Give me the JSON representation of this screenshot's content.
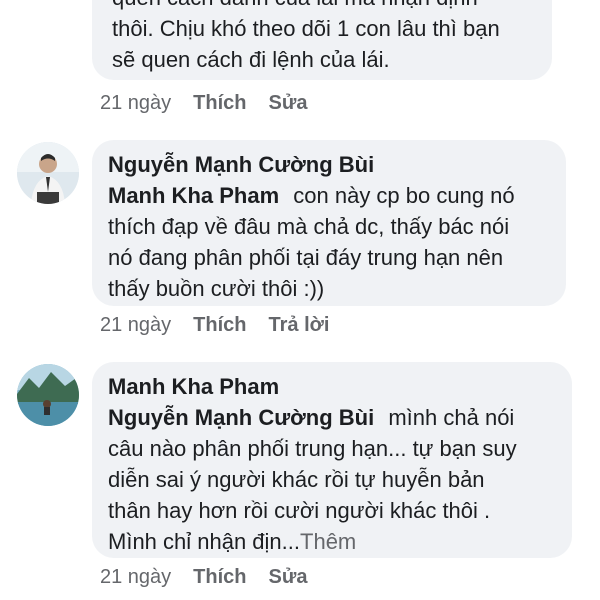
{
  "comment1": {
    "lines": [
      "quen cách đánh của lái mà nhận định",
      "thôi. Chịu khó theo dõi 1 con lâu thì bạn",
      "sẽ quen cách đi lệnh của lái."
    ],
    "time": "21 ngày",
    "like_label": "Thích",
    "edit_label": "Sửa"
  },
  "comment2": {
    "author": "Nguyễn Mạnh Cường Bùi",
    "mention": "Manh Kha Pham",
    "line1_rest": "con này cp bo cung nó",
    "lines": [
      "thích đạp về đâu mà chả dc, thấy bác nói",
      "nó đang phân phối tại đáy trung hạn nên",
      "thấy buồn cười thôi :))"
    ],
    "time": "21 ngày",
    "like_label": "Thích",
    "reply_label": "Trả lời"
  },
  "comment3": {
    "author": "Manh Kha Pham",
    "mention": "Nguyễn Mạnh Cường Bùi",
    "line1_rest": "mình chả nói",
    "lines": [
      "câu nào phân phối trung hạn... tự bạn suy",
      "diễn sai ý người khác rồi tự huyễn bản",
      "thân hay hơn rồi cười người khác thôi .",
      "Mình chỉ nhận địn..."
    ],
    "see_more": "Thêm",
    "time": "21 ngày",
    "like_label": "Thích",
    "edit_label": "Sửa"
  }
}
